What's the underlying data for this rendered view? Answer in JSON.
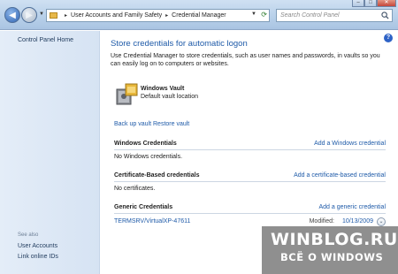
{
  "address": {
    "crumbs": [
      "User Accounts and Family Safety",
      "Credential Manager"
    ],
    "separator": "▸"
  },
  "search": {
    "placeholder": "Search Control Panel"
  },
  "sidebar": {
    "home": "Control Panel Home",
    "see_also": "See also",
    "links": [
      "User Accounts",
      "Link online IDs"
    ]
  },
  "main": {
    "title": "Store credentials for automatic logon",
    "description": "Use Credential Manager to store credentials, such as user names and passwords, in vaults so you can easily log on to computers or websites.",
    "vault": {
      "name": "Windows Vault",
      "location": "Default vault location"
    },
    "backup": "Back up vault",
    "restore": "Restore vault",
    "sections": [
      {
        "title": "Windows Credentials",
        "action": "Add a Windows credential",
        "empty": "No Windows credentials."
      },
      {
        "title": "Certificate-Based credentials",
        "action": "Add a certificate-based credential",
        "empty": "No certificates."
      },
      {
        "title": "Generic Credentials",
        "action": "Add a generic credential",
        "items": [
          {
            "name": "TERMSRV/VirtualXP-47611",
            "modified_label": "Modified:",
            "modified_date": "10/13/2009"
          }
        ]
      }
    ]
  },
  "watermark": {
    "line1": "WINBLOG.RU",
    "line2": "ВСЁ О WINDOWS"
  },
  "colors": {
    "link": "#1e5aa8",
    "accent": "#2d62c6"
  },
  "icons": [
    "back-arrow-icon",
    "forward-arrow-icon",
    "folder-icon",
    "refresh-icon",
    "search-icon",
    "help-icon",
    "vault-icon",
    "expand-chevron-icon"
  ]
}
